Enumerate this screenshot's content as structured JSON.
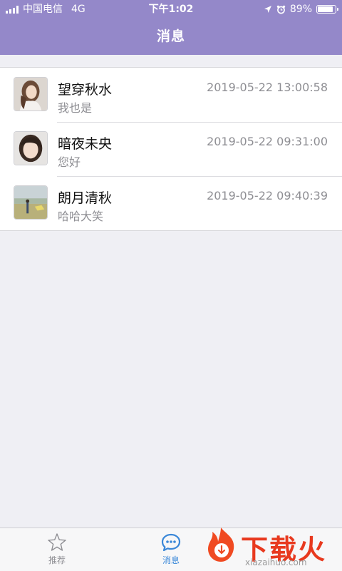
{
  "status_bar": {
    "carrier": "中国电信",
    "network": "4G",
    "time": "下午1:02",
    "battery": "89%",
    "battery_level": 0.89
  },
  "nav": {
    "title": "消息"
  },
  "messages": [
    {
      "name": "望穿秋水",
      "preview": "我也是",
      "time": "2019-05-22 13:00:58"
    },
    {
      "name": "暗夜未央",
      "preview": "您好",
      "time": "2019-05-22 09:31:00"
    },
    {
      "name": "朗月清秋",
      "preview": "哈哈大笑",
      "time": "2019-05-22 09:40:39"
    }
  ],
  "tabbar": {
    "tabs": [
      {
        "label": "推荐",
        "icon": "star-icon",
        "active": false
      },
      {
        "label": "消息",
        "icon": "chat-bubble-icon",
        "active": true
      }
    ]
  },
  "watermark": {
    "text": "下载火",
    "url": "xiazaihuo.com"
  },
  "colors": {
    "header": "#9488c9",
    "accent": "#3a87d8",
    "background": "#efeff4",
    "watermark": "#e8391e"
  }
}
